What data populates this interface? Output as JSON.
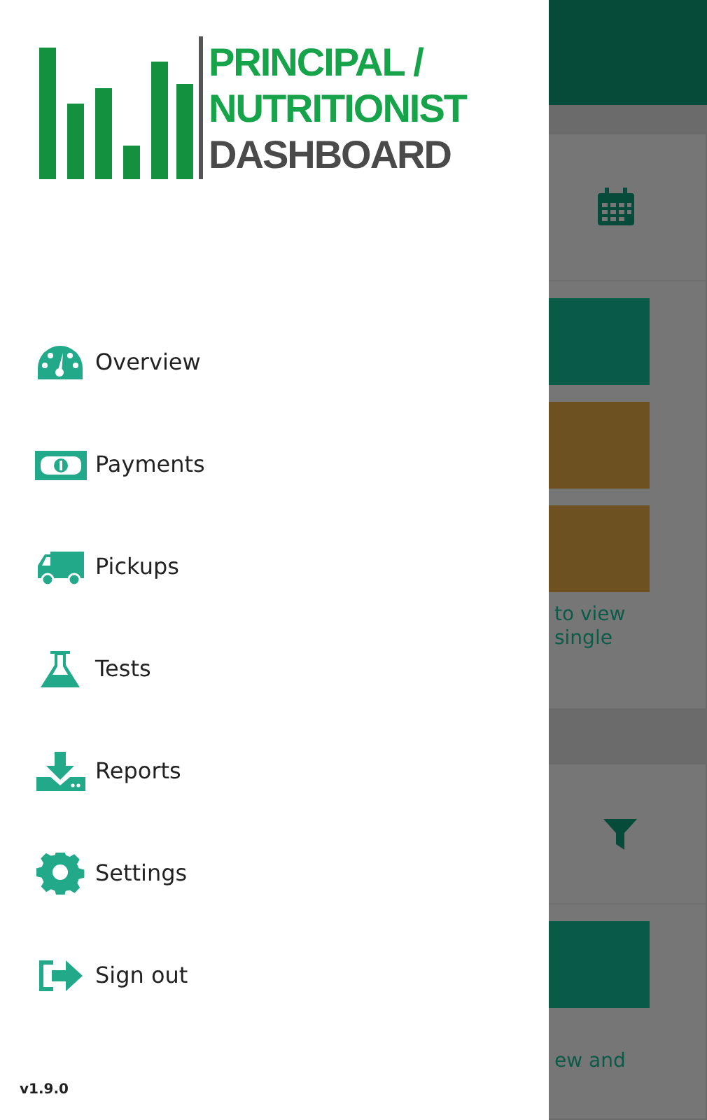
{
  "drawer": {
    "logo": {
      "lines": [
        "PRINCIPAL /",
        "NUTRITIONIST",
        "DASHBOARD"
      ]
    },
    "menu": [
      {
        "label": "Overview",
        "kind": "gauge"
      },
      {
        "label": "Payments",
        "kind": "money"
      },
      {
        "label": "Pickups",
        "kind": "truck"
      },
      {
        "label": "Tests",
        "kind": "flask"
      },
      {
        "label": "Reports",
        "kind": "download"
      },
      {
        "label": "Settings",
        "kind": "gear"
      },
      {
        "label": "Sign out",
        "kind": "signout"
      }
    ],
    "version": "v1.9.0"
  },
  "background_screen": {
    "cards": [
      {
        "kind": "calendar",
        "buttons": [
          {
            "color": "#0a5a48"
          },
          {
            "color": "#6e5121"
          },
          {
            "color": "#6e5121"
          }
        ],
        "text_lines": [
          "to view",
          "single"
        ]
      },
      {
        "kind": "filter",
        "buttons": [
          {
            "color": "#0a5a48"
          }
        ],
        "text_lines": [
          "ew and"
        ]
      }
    ]
  }
}
